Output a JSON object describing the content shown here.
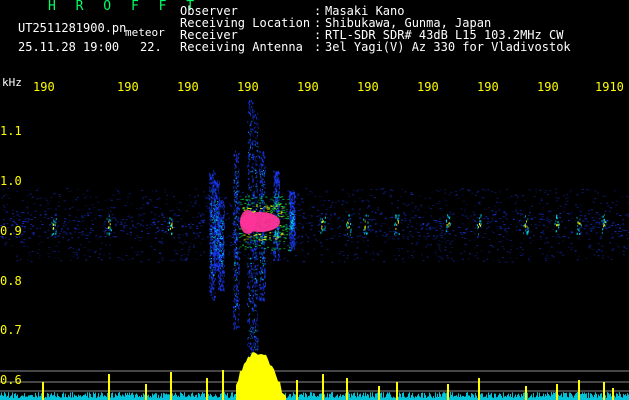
{
  "header": {
    "brand": "H R O F F T",
    "filename": "UT2511281900.pn",
    "mode": "meteor",
    "timestamp": "25.11.28 19:00",
    "count": "22.",
    "info": [
      {
        "label": "Observer",
        "value": "Masaki Kano"
      },
      {
        "label": "Receiving Location",
        "value": "Shibukawa, Gunma, Japan"
      },
      {
        "label": "Receiver",
        "value": "RTL-SDR SDR# 43dB L15 103.2MHz CW"
      },
      {
        "label": "Receiving Antenna",
        "value": "3el Yagi(V) Az 330 for Vladivostok"
      }
    ],
    "separator": ":"
  },
  "axes": {
    "y_unit": "kHz",
    "x_ticks": [
      "190",
      "190",
      "190",
      "190",
      "190",
      "190",
      "190",
      "190",
      "190",
      "1910"
    ],
    "y_ticks": [
      "1.1",
      "1.0",
      "0.9",
      "0.8",
      "0.7",
      "0.6"
    ]
  },
  "colors": {
    "background": "#000000",
    "label": "#ffffff",
    "axis": "#ffff00",
    "brand": "#00ff66",
    "echo_core": "#ff3399",
    "echo_mid": "#00cc44",
    "echo_low": "#1a3cff",
    "noise": "#00e5ff",
    "spike": "#ffff00"
  }
}
